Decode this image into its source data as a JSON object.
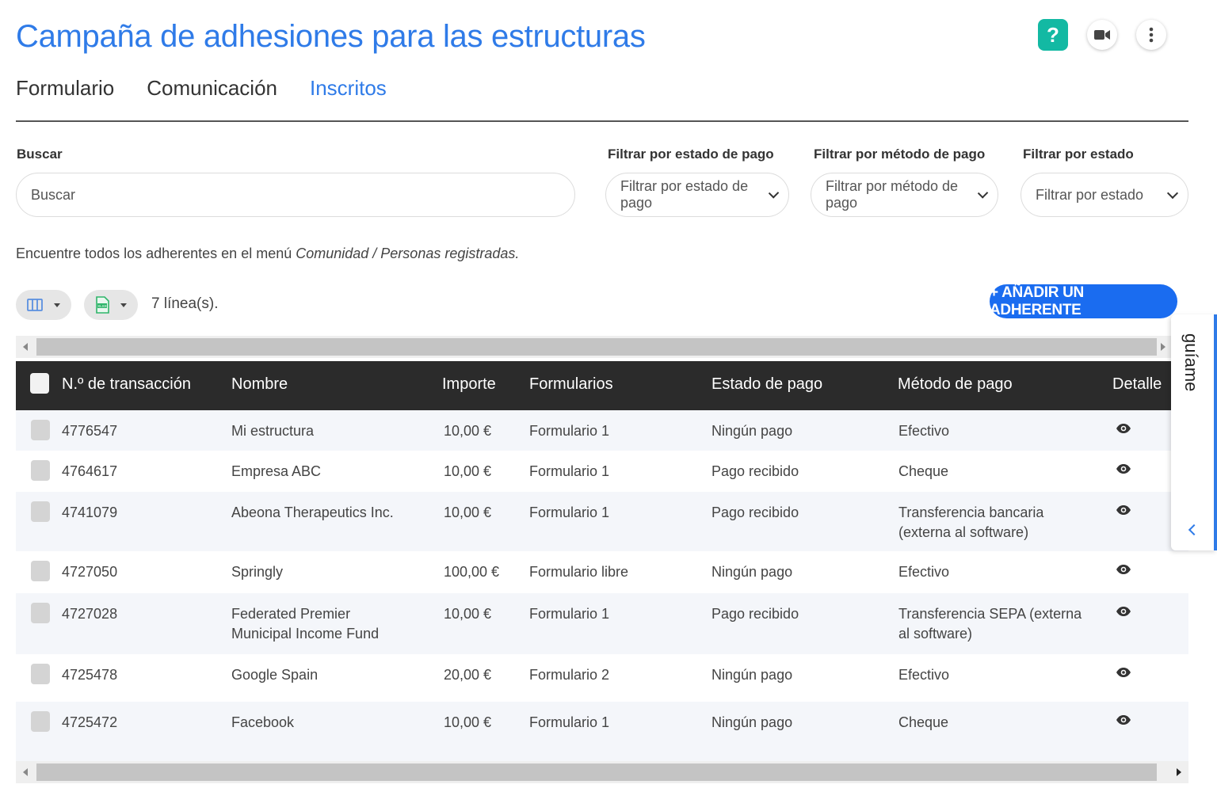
{
  "page": {
    "title": "Campaña de adhesiones para las estructuras",
    "help_label": "?"
  },
  "tabs": [
    {
      "label": "Formulario"
    },
    {
      "label": "Comunicación"
    },
    {
      "label": "Inscritos"
    }
  ],
  "filters": {
    "search_label": "Buscar",
    "search_placeholder": "Buscar",
    "payment_status_label": "Filtrar por estado de pago",
    "payment_status_value": "Filtrar por estado de pago",
    "payment_method_label": "Filtrar por método de pago",
    "payment_method_value": "Filtrar por método de pago",
    "status_label": "Filtrar por estado",
    "status_value": "Filtrar por estado"
  },
  "info": {
    "prefix": "Encuentre todos los adherentes en el menú ",
    "menu_path": "Comunidad / Personas registradas."
  },
  "toolbar": {
    "line_count": "7 línea(s).",
    "add_button": "+ AÑADIR UN ADHERENTE",
    "export_icon_text": "XLSX"
  },
  "table": {
    "columns": [
      "N.º de transacción",
      "Nombre",
      "Importe",
      "Formularios",
      "Estado de pago",
      "Método de pago",
      "Detalle"
    ],
    "rows": [
      {
        "id": "4776547",
        "name": "Mi estructura",
        "amount": "10,00 €",
        "form": "Formulario 1",
        "payment_status": "Ningún pago",
        "method": "Efectivo"
      },
      {
        "id": "4764617",
        "name": "Empresa ABC",
        "amount": "10,00 €",
        "form": "Formulario 1",
        "payment_status": "Pago recibido",
        "method": "Cheque"
      },
      {
        "id": "4741079",
        "name": "Abeona Therapeutics Inc.",
        "amount": "10,00 €",
        "form": "Formulario 1",
        "payment_status": "Pago recibido",
        "method": "Transferencia bancaria (externa al software)"
      },
      {
        "id": "4727050",
        "name": "Springly",
        "amount": "100,00 €",
        "form": "Formulario libre",
        "payment_status": "Ningún pago",
        "method": "Efectivo"
      },
      {
        "id": "4727028",
        "name": "Federated Premier Municipal Income Fund",
        "amount": "10,00 €",
        "form": "Formulario 1",
        "payment_status": "Pago recibido",
        "method": "Transferencia SEPA (externa al software)"
      },
      {
        "id": "4725478",
        "name": "Google Spain",
        "amount": "20,00 €",
        "form": "Formulario 2",
        "payment_status": "Ningún pago",
        "method": "Efectivo"
      },
      {
        "id": "4725472",
        "name": "Facebook",
        "amount": "10,00 €",
        "form": "Formulario 1",
        "payment_status": "Ningún pago",
        "method": "Cheque"
      }
    ]
  },
  "guide": {
    "label": "guíame"
  },
  "colors": {
    "accent": "#2f7be8",
    "primary_button": "#1a6cf0",
    "help": "#13b9a3",
    "table_header": "#2b2b2b"
  }
}
